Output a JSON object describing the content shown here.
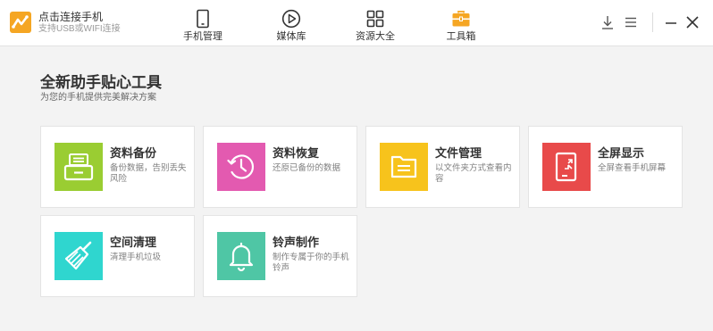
{
  "header": {
    "connection_title": "点击连接手机",
    "connection_subtitle": "支持USB或WIFI连接",
    "nav": [
      {
        "label": "手机管理",
        "icon": "phone-icon"
      },
      {
        "label": "媒体库",
        "icon": "play-circle-icon"
      },
      {
        "label": "资源大全",
        "icon": "grid-icon"
      },
      {
        "label": "工具箱",
        "icon": "toolbox-icon",
        "active": true
      }
    ],
    "window_controls": [
      "download-icon",
      "menu-icon",
      "minimize-icon",
      "close-icon"
    ]
  },
  "main": {
    "title": "全新助手贴心工具",
    "subtitle": "为您的手机提供完美解决方案",
    "tools": [
      {
        "title": "资料备份",
        "desc": "备份数据，告别丢失风险",
        "icon": "backup-drive-icon",
        "color": "#9acd32"
      },
      {
        "title": "资料恢复",
        "desc": "还原已备份的数据",
        "icon": "restore-clock-icon",
        "color": "#e35ab0"
      },
      {
        "title": "文件管理",
        "desc": "以文件夹方式查看内容",
        "icon": "folder-icon",
        "color": "#f7c31c"
      },
      {
        "title": "全屏显示",
        "desc": "全屏查看手机屏幕",
        "icon": "fullscreen-phone-icon",
        "color": "#e84a4a"
      },
      {
        "title": "空间清理",
        "desc": "清理手机垃圾",
        "icon": "broom-icon",
        "color": "#2fd6cf"
      },
      {
        "title": "铃声制作",
        "desc": "制作专属于你的手机铃声",
        "icon": "bell-icon",
        "color": "#4fc6a5"
      }
    ]
  },
  "colors": {
    "accent_orange": "#f5a623",
    "background": "#f3f3f3"
  }
}
